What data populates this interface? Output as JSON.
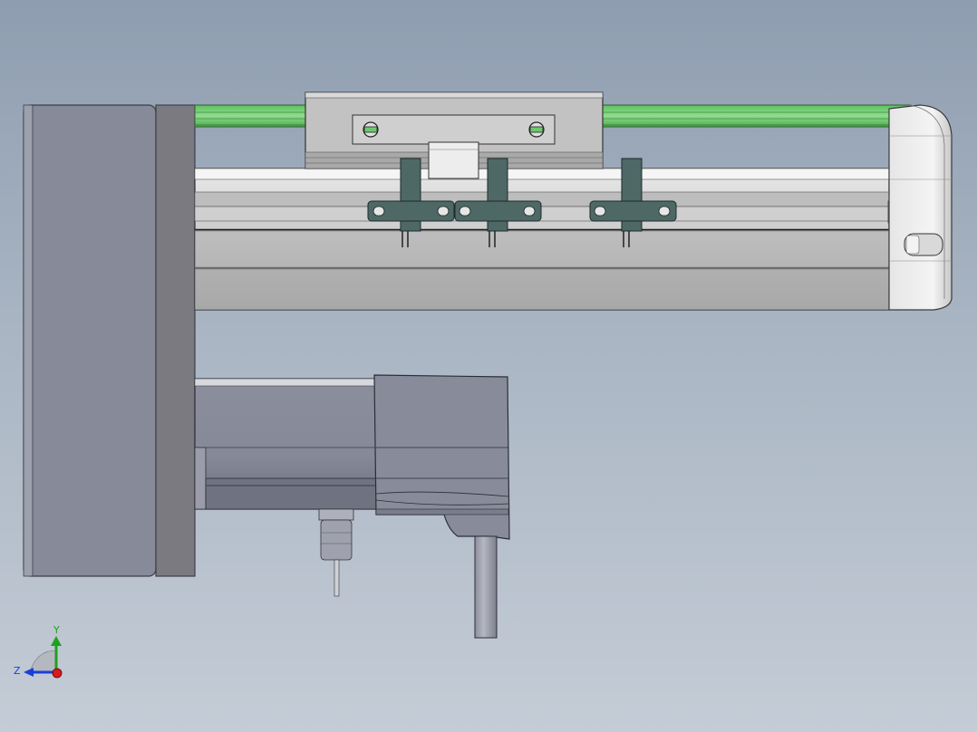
{
  "viewport": {
    "background_top": "#8e9db0",
    "background_bottom": "#c4ccd6"
  },
  "model": {
    "accent_green": "#6cc96c",
    "bracket_color": "#4e6866",
    "body_gray": "#8a8d99",
    "rail_gray": "#b8b8b8"
  },
  "triad": {
    "y_label": "Y",
    "z_label": "Z",
    "y_color": "#1fa01f",
    "z_color": "#1a3fd6",
    "x_color": "#d41a1a"
  }
}
